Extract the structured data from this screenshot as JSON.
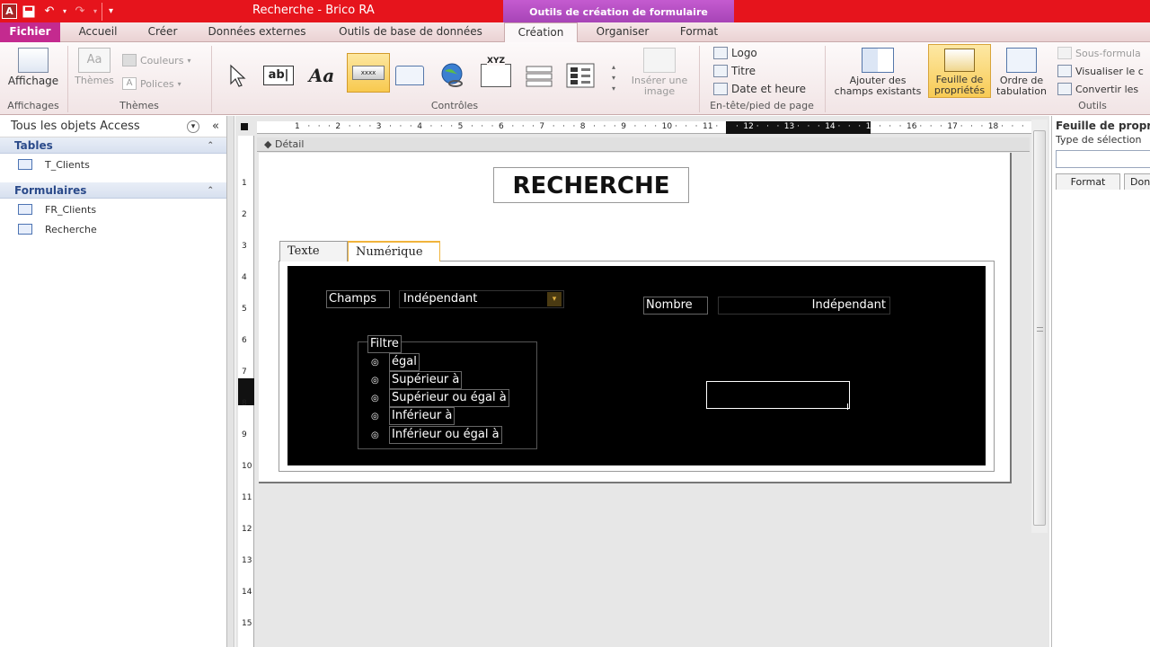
{
  "window": {
    "title": "Recherche  -  Brico RA",
    "contextual_group": "Outils de création de formulaire",
    "app_icon": "A"
  },
  "tabs": {
    "fichier": "Fichier",
    "accueil": "Accueil",
    "creer": "Créer",
    "donnees_externes": "Données externes",
    "outils_bd": "Outils de base de données",
    "creation": "Création",
    "organiser": "Organiser",
    "format": "Format"
  },
  "ribbon": {
    "affichages": {
      "button": "Affichage",
      "group": "Affichages"
    },
    "themes": {
      "button": "Thèmes",
      "couleurs": "Couleurs",
      "polices": "Polices",
      "group": "Thèmes"
    },
    "controles": {
      "group": "Contrôles",
      "xyz": "XYZ",
      "textbox_sample": "ab|",
      "label_sample": "Aa"
    },
    "inserer_image": {
      "line1": "Insérer une",
      "line2": "image"
    },
    "entete": {
      "logo": "Logo",
      "titre": "Titre",
      "date_heure": "Date et heure",
      "group": "En-tête/pied de page"
    },
    "outils": {
      "ajouter_champs_l1": "Ajouter des",
      "ajouter_champs_l2": "champs existants",
      "feuille_props_l1": "Feuille de",
      "feuille_props_l2": "propriétés",
      "ordre_tab_l1": "Ordre de",
      "ordre_tab_l2": "tabulation",
      "sous_formulaire": "Sous-formula",
      "visualiser": "Visualiser le c",
      "convertir": "Convertir les",
      "group": "Outils"
    }
  },
  "nav": {
    "header": "Tous les objets Access",
    "groups": [
      {
        "title": "Tables",
        "items": [
          "T_Clients"
        ]
      },
      {
        "title": "Formulaires",
        "items": [
          "FR_Clients",
          "Recherche"
        ]
      }
    ]
  },
  "design": {
    "section": "Détail",
    "ruler_h": [
      "1",
      "2",
      "3",
      "4",
      "5",
      "6",
      "7",
      "8",
      "9",
      "10",
      "11",
      "12",
      "13",
      "14",
      "15",
      "16",
      "17",
      "18"
    ],
    "ruler_v": [
      "1",
      "2",
      "3",
      "4",
      "5",
      "6",
      "7",
      "8",
      "9",
      "10",
      "11",
      "12",
      "13",
      "14",
      "15"
    ],
    "form_title": "RECHERCHE",
    "tab_control": {
      "tabs": [
        "Texte",
        "Numérique"
      ],
      "champs_label": "Champs",
      "champs_value": "Indépendant",
      "nombre_label": "Nombre",
      "nombre_value": "Indépendant",
      "filtre_label": "Filtre",
      "options": [
        "égal",
        "Supérieur à",
        "Supérieur ou égal à",
        "Inférieur à",
        "Inférieur ou égal à"
      ]
    }
  },
  "property_sheet": {
    "title": "Feuille de propri",
    "selection_label": "Type de sélection",
    "tabs": [
      "Format",
      "Don"
    ]
  },
  "colors": {
    "title_bar": "#e6141c",
    "contextual": "#b24bc2",
    "fichier_tab": "#c42a8f",
    "highlight": "#f8cb55"
  }
}
